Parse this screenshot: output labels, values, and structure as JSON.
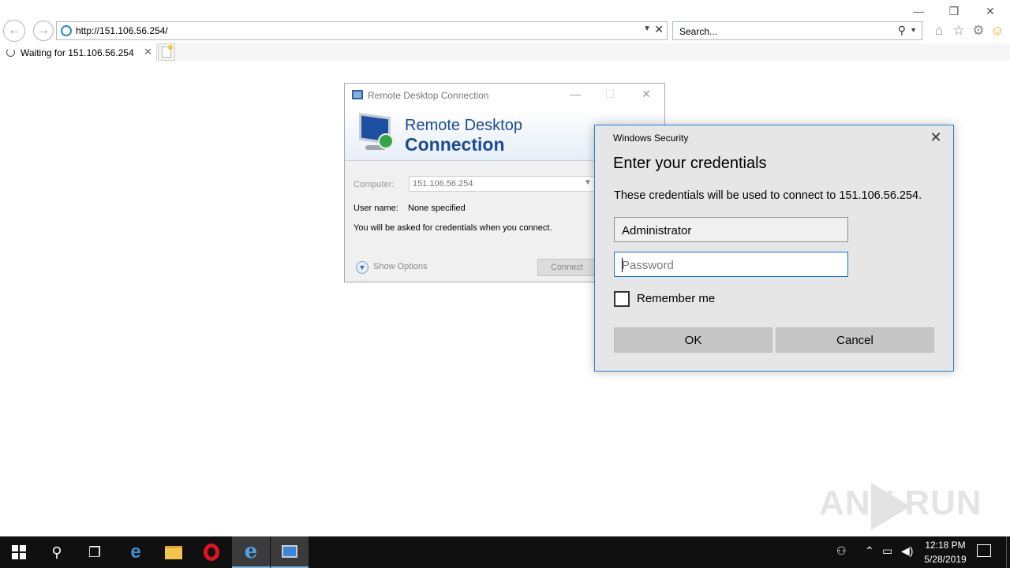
{
  "browser": {
    "address": "http://151.106.56.254/",
    "search_placeholder": "Search...",
    "tab_title": "Waiting for 151.106.56.254",
    "window_controls": {
      "minimize": "—",
      "restore": "❐",
      "close": "✕"
    }
  },
  "rdc": {
    "title": "Remote Desktop Connection",
    "banner_line1": "Remote Desktop",
    "banner_line2": "Connection",
    "computer_label": "Computer:",
    "computer_value": "151.106.56.254",
    "username_label": "User name:",
    "username_value": "None specified",
    "info_text": "You will be asked for credentials when you connect.",
    "show_options": "Show Options",
    "connect": "Connect"
  },
  "security": {
    "title": "Windows Security",
    "heading": "Enter your credentials",
    "description": "These credentials will be used to connect to 151.106.56.254.",
    "username_value": "Administrator",
    "password_placeholder": "Password",
    "remember_label": "Remember me",
    "ok": "OK",
    "cancel": "Cancel",
    "accent_color": "#2c7fd4"
  },
  "watermark": "ANY RUN",
  "taskbar": {
    "time": "12:18 PM",
    "date": "5/28/2019",
    "pinned": [
      "start",
      "search",
      "task-view",
      "edge",
      "file-explorer",
      "opera",
      "internet-explorer",
      "remote-desktop"
    ]
  }
}
